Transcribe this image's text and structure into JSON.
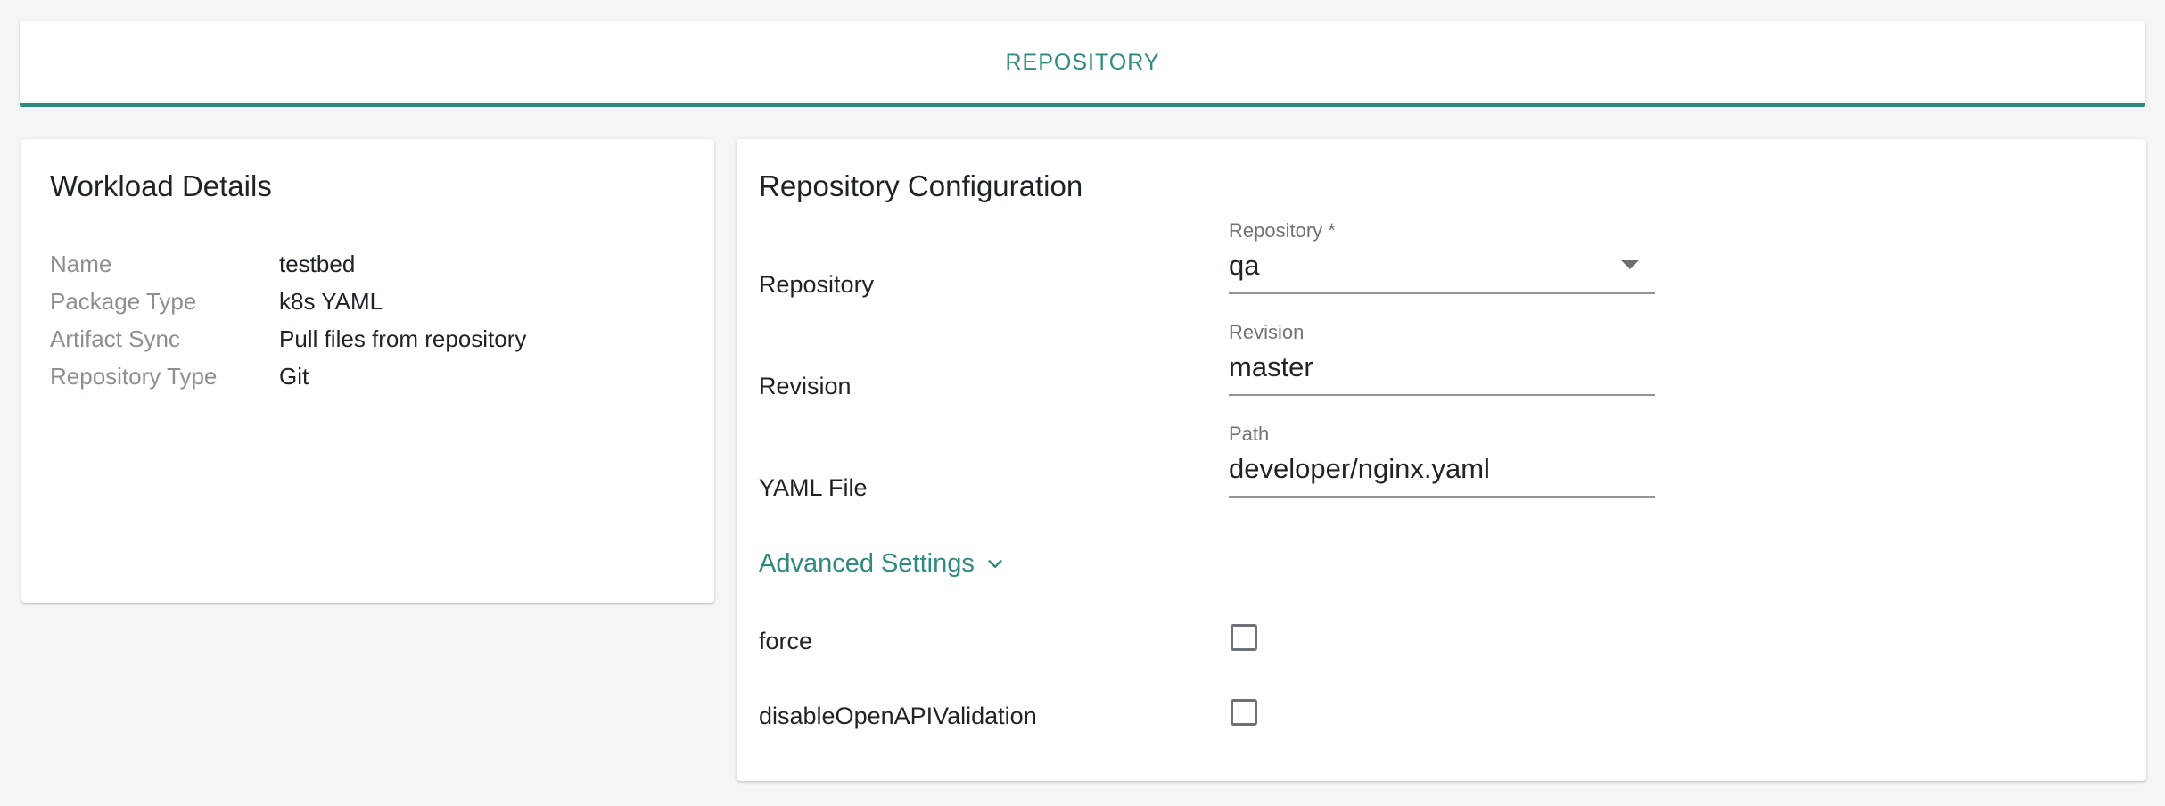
{
  "tabs": [
    {
      "label": "REPOSITORY",
      "active": true
    }
  ],
  "colors": {
    "accent": "#2e8b7e",
    "background": "#f4f5f6"
  },
  "workload_details": {
    "title": "Workload Details",
    "rows": [
      {
        "label": "Name",
        "value": "testbed"
      },
      {
        "label": "Package Type",
        "value": "k8s YAML"
      },
      {
        "label": "Artifact Sync",
        "value": "Pull files from repository"
      },
      {
        "label": "Repository Type",
        "value": "Git"
      }
    ]
  },
  "repository_configuration": {
    "title": "Repository Configuration",
    "repository": {
      "row_label": "Repository",
      "field_label": "Repository *",
      "value": "qa",
      "icon": "chevron-down-icon"
    },
    "revision": {
      "row_label": "Revision",
      "field_label": "Revision",
      "value": "master"
    },
    "path": {
      "row_label": "YAML File",
      "field_label": "Path",
      "value": "developer/nginx.yaml"
    },
    "advanced_settings": {
      "label": "Advanced Settings",
      "icon": "chevron-down-icon",
      "expanded": true
    },
    "options": [
      {
        "label": "force",
        "checked": false
      },
      {
        "label": "disableOpenAPIValidation",
        "checked": false
      }
    ]
  }
}
